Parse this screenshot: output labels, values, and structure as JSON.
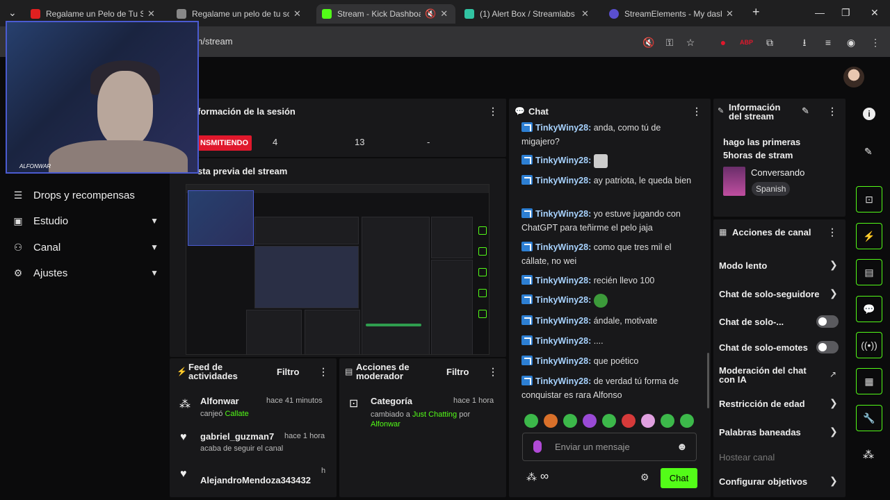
{
  "browser": {
    "tabs": [
      {
        "title": "Regalame un Pelo de Tu Sob",
        "fav_color": "#e02020"
      },
      {
        "title": "Regalame un pelo de tu sob",
        "fav_color": "#888888"
      },
      {
        "title": "Stream - Kick Dashboard",
        "fav_color": "#53fc18"
      },
      {
        "title": "(1) Alert Box / Streamlabs",
        "fav_color": "#31c3a2"
      },
      {
        "title": "StreamElements - My dashb",
        "fav_color": "#5a4fcf"
      }
    ],
    "url": "n/stream"
  },
  "webcam": {
    "tag": "ALFONWAR"
  },
  "nav": {
    "items": [
      {
        "label": "Drops y recompensas",
        "icon": "bars-icon"
      },
      {
        "label": "Estudio",
        "icon": "studio-icon"
      },
      {
        "label": "Canal",
        "icon": "people-icon"
      },
      {
        "label": "Ajustes",
        "icon": "gear-icon"
      }
    ]
  },
  "session": {
    "title": "formación de la sesión",
    "live_label": "NSMITIENDO",
    "stat1": "4",
    "stat2": "13",
    "stat3": "-",
    "preview_title": "sta previa del stream"
  },
  "feed": {
    "title_line1": "Feed de",
    "title_line2": "actividades",
    "filter": "Filtro",
    "items": [
      {
        "name": "Alfonwar",
        "time": "hace 41 minutos",
        "sub_prefix": "canjeó",
        "sub_highlight": "Callate"
      },
      {
        "name": "gabriel_guzman7",
        "time": "hace 1 hora",
        "sub_prefix": "acaba de seguir el canal",
        "sub_highlight": ""
      },
      {
        "name": "AlejandroMendoza343432",
        "time": "h",
        "sub_prefix": "",
        "sub_highlight": ""
      }
    ]
  },
  "modactions": {
    "title_line1": "Acciones de",
    "title_line2": "moderador",
    "filter": "Filtro",
    "item": {
      "name": "Categoría",
      "time": "hace 1 hora",
      "prefix": "cambiado a",
      "category": "Just Chatting",
      "by": "por",
      "user": "Alfonwar"
    }
  },
  "chat": {
    "title": "Chat",
    "messages": [
      {
        "user": "TinkyWiny28:",
        "text": "anda, como tú de migajero?"
      },
      {
        "user": "TinkyWiny28:",
        "text": ""
      },
      {
        "user": "TinkyWiny28:",
        "text": "ay patriota, le queda bien"
      },
      {
        "user": "TinkyWiny28:",
        "text": "yo estuve jugando con ChatGPT para teñirme el pelo jaja"
      },
      {
        "user": "TinkyWiny28:",
        "text": "como que tres mil el cállate, no wei"
      },
      {
        "user": "TinkyWiny28:",
        "text": "recién llevo 100"
      },
      {
        "user": "TinkyWiny28:",
        "text": ""
      },
      {
        "user": "TinkyWiny28:",
        "text": "ándale, motivate"
      },
      {
        "user": "TinkyWiny28:",
        "text": "...."
      },
      {
        "user": "TinkyWiny28:",
        "text": "que poético"
      },
      {
        "user": "TinkyWiny28:",
        "text": "de verdad tú forma de conquistar es rara Alfonso"
      }
    ],
    "placeholder": "Enviar un mensaje",
    "send": "Chat"
  },
  "streaminfo": {
    "title_line1": "Información",
    "title_line2": "del stream",
    "stream_title": "hago las primeras 5horas de stram",
    "category": "Conversando",
    "language": "Spanish"
  },
  "channel_actions": {
    "title": "Acciones de canal",
    "items": [
      {
        "label": "Modo lento",
        "control": "chevron"
      },
      {
        "label": "Chat de solo-seguidore",
        "control": "chevron"
      },
      {
        "label": "Chat de solo-...",
        "control": "toggle"
      },
      {
        "label": "Chat de solo-emotes",
        "control": "toggle"
      },
      {
        "label": "Moderación del chat con IA",
        "control": "external"
      },
      {
        "label": "Restricción de edad",
        "control": "chevron"
      },
      {
        "label": "Palabras baneadas",
        "control": "chevron"
      },
      {
        "label": "Hostear canal",
        "control": "none"
      },
      {
        "label": "Configurar objetivos",
        "control": "chevron"
      }
    ]
  },
  "colors": {
    "accent": "#53fc18",
    "live": "#e0182c",
    "username": "#a8d3ff"
  }
}
